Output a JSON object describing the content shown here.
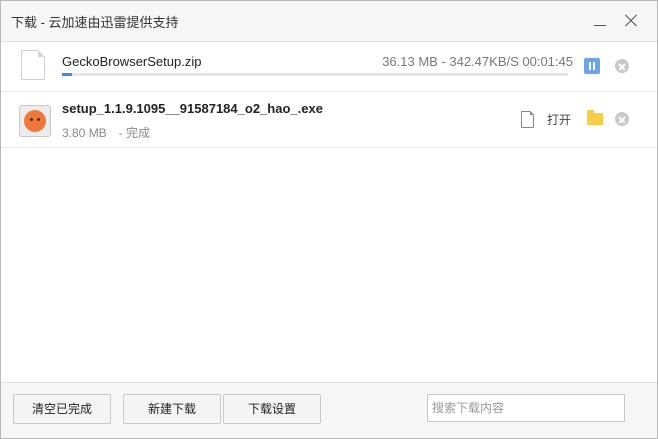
{
  "window": {
    "title": "下载 - 云加速由迅雷提供支持"
  },
  "downloads": [
    {
      "filename": "GeckoBrowserSetup.zip",
      "stats": "36.13 MB - 342.47KB/S 00:01:45",
      "progress_percent": 2,
      "state": "downloading",
      "icon": "file-icon"
    },
    {
      "filename": "setup_1.1.9.1095__91587184_o2_hao_.exe",
      "size": "3.80 MB",
      "status": "- 完成",
      "open_label": "打开",
      "state": "complete",
      "icon": "app-icon"
    }
  ],
  "footer": {
    "clear_label": "清空已完成",
    "new_label": "新建下载",
    "settings_label": "下载设置",
    "search_placeholder": "搜索下载内容"
  },
  "colors": {
    "accent": "#3b8ee8",
    "pause_button": "#6aa6e6",
    "folder": "#f7cd45",
    "remove": "#c9c9c9"
  }
}
